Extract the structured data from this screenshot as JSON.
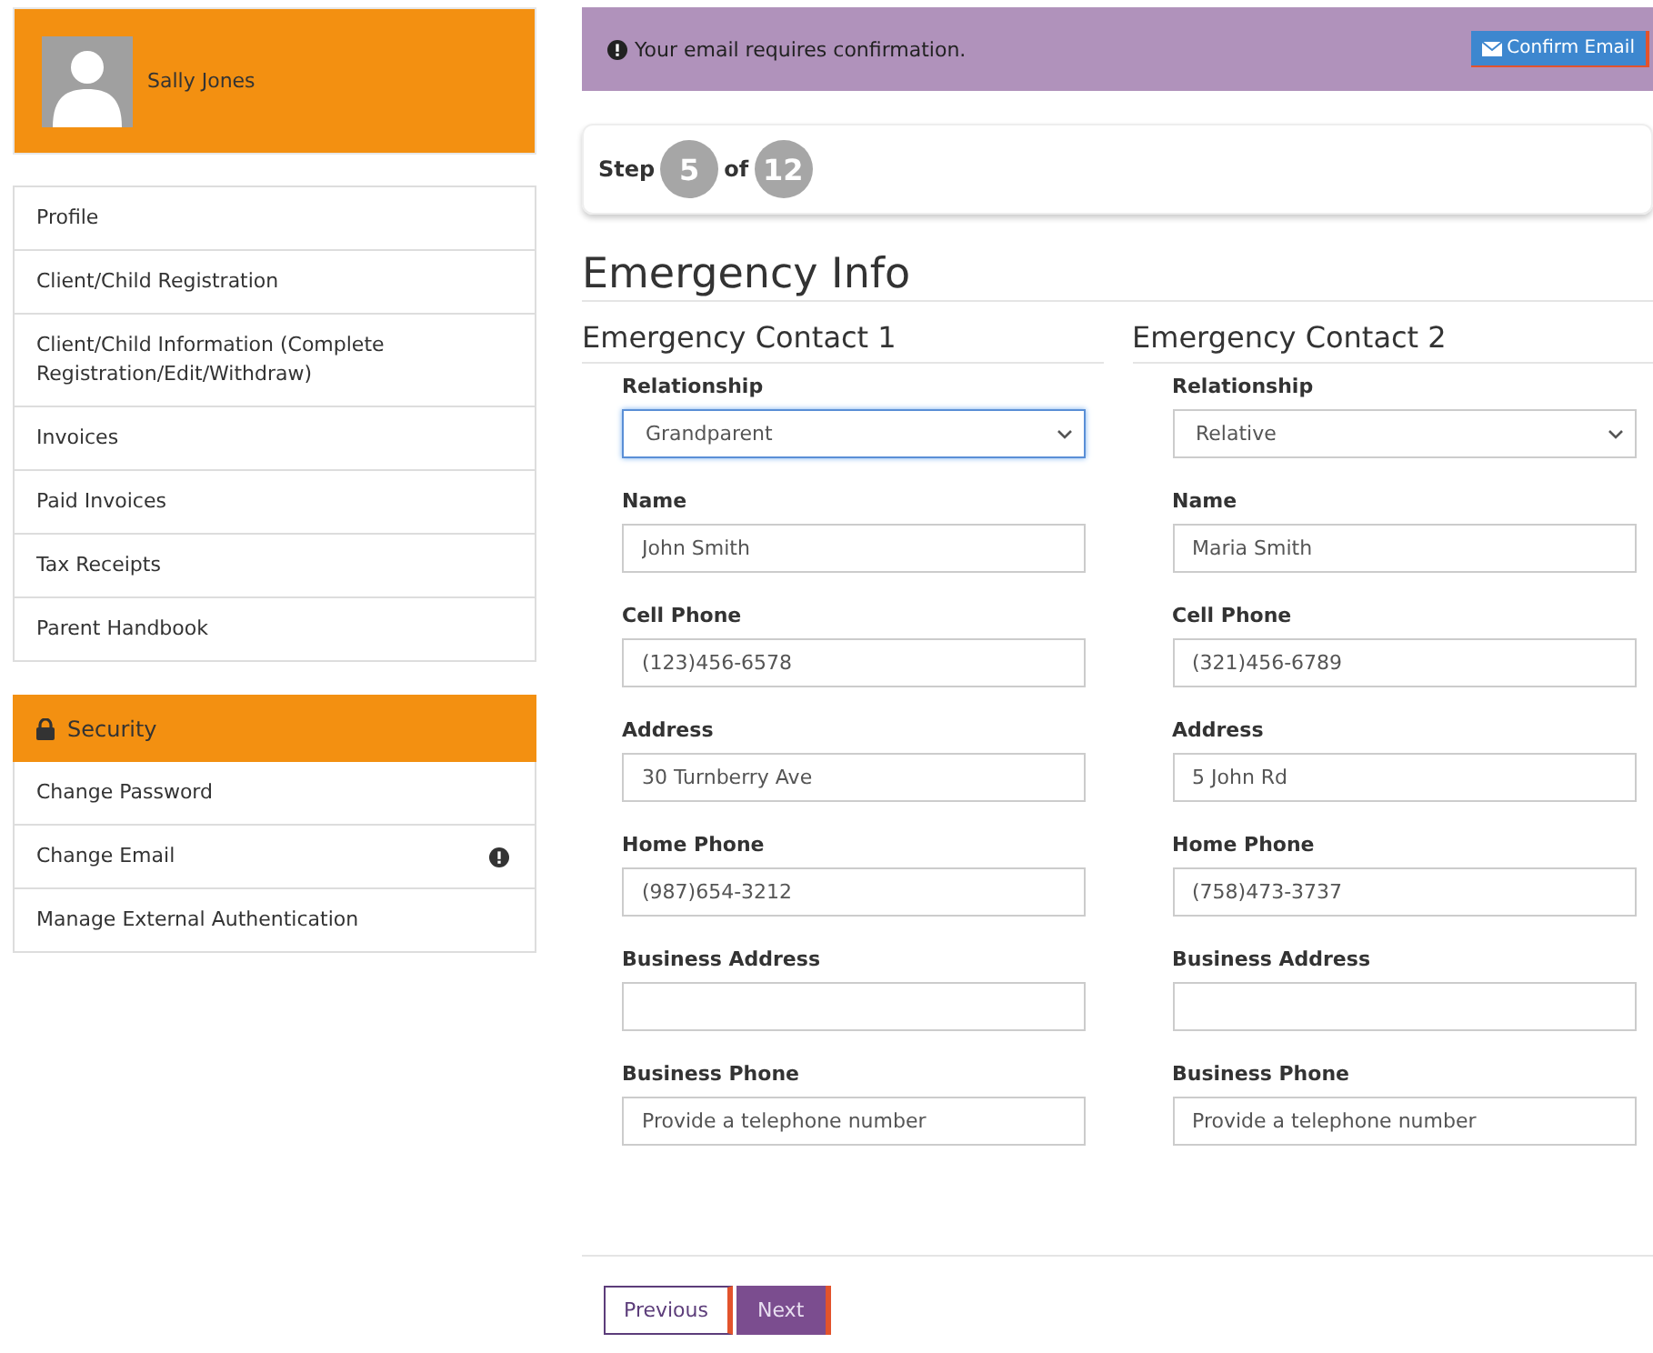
{
  "user": {
    "name": "Sally Jones"
  },
  "menu": [
    {
      "label": "Profile"
    },
    {
      "label": "Client/Child Registration"
    },
    {
      "label": "Client/Child Information (Complete Registration/Edit/Withdraw)"
    },
    {
      "label": "Invoices"
    },
    {
      "label": "Paid Invoices"
    },
    {
      "label": "Tax Receipts"
    },
    {
      "label": "Parent Handbook"
    }
  ],
  "security": {
    "title": "Security",
    "items": [
      {
        "label": "Change Password",
        "alert": false
      },
      {
        "label": "Change Email",
        "alert": true
      },
      {
        "label": "Manage External Authentication",
        "alert": false
      }
    ]
  },
  "banner": {
    "message": "Your email requires confirmation.",
    "button": "Confirm Email"
  },
  "step": {
    "label": "Step",
    "current": "5",
    "of": "of",
    "total": "12"
  },
  "title": "Emergency Info",
  "contacts": [
    {
      "heading": "Emergency Contact 1",
      "fields": [
        {
          "kind": "select",
          "label": "Relationship",
          "value": "Grandparent",
          "focused": true
        },
        {
          "kind": "text",
          "label": "Name",
          "value": "John Smith",
          "focused": false
        },
        {
          "kind": "text",
          "label": "Cell Phone",
          "value": "(123)456-6578",
          "focused": false
        },
        {
          "kind": "text",
          "label": "Address",
          "value": "30 Turnberry Ave",
          "focused": false
        },
        {
          "kind": "text",
          "label": "Home Phone",
          "value": "(987)654-3212",
          "focused": false
        },
        {
          "kind": "text",
          "label": "Business Address",
          "focused": false
        },
        {
          "kind": "text",
          "label": "Business Phone",
          "placeholder": "Provide a telephone number",
          "focused": false
        }
      ]
    },
    {
      "heading": "Emergency Contact 2",
      "fields": [
        {
          "kind": "select",
          "label": "Relationship",
          "value": "Relative",
          "focused": false
        },
        {
          "kind": "text",
          "label": "Name",
          "value": "Maria Smith",
          "focused": false
        },
        {
          "kind": "text",
          "label": "Cell Phone",
          "value": "(321)456-6789",
          "focused": false
        },
        {
          "kind": "text",
          "label": "Address",
          "value": "5 John Rd",
          "focused": false
        },
        {
          "kind": "text",
          "label": "Home Phone",
          "value": "(758)473-3737",
          "focused": false
        },
        {
          "kind": "text",
          "label": "Business Address",
          "focused": false
        },
        {
          "kind": "text",
          "label": "Business Phone",
          "placeholder": "Provide a telephone number",
          "focused": false
        }
      ]
    }
  ],
  "buttons": {
    "previous": "Previous",
    "next": "Next"
  }
}
